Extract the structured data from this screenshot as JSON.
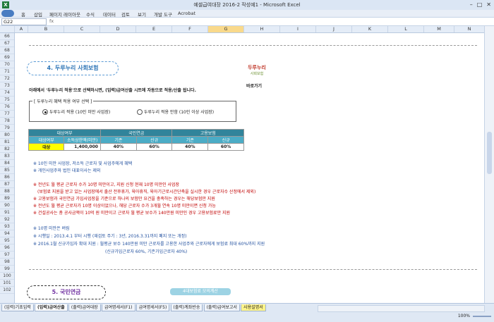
{
  "window": {
    "title": "예셀급여대장 2016-2 작성예1 - Microsoft Excel"
  },
  "ribbon_tabs": [
    "홈",
    "삽입",
    "페이지 레이아웃",
    "수식",
    "데이터",
    "검토",
    "보기",
    "개발 도구",
    "Acrobat"
  ],
  "formula_bar": {
    "name_box": "G22",
    "fx": "fx"
  },
  "columns": [
    "A",
    "B",
    "C",
    "D",
    "E",
    "F",
    "G",
    "H",
    "I",
    "J",
    "K",
    "L",
    "M",
    "N"
  ],
  "selected_column": "G",
  "rows": [
    "66",
    "67",
    "68",
    "69",
    "70",
    "71",
    "72",
    "73",
    "74",
    "75",
    "76",
    "77",
    "78",
    "79",
    "80",
    "81",
    "82",
    "83",
    "84",
    "85",
    "86",
    "87",
    "88",
    "89",
    "90",
    "91",
    "92",
    "93",
    "94",
    "95",
    "96",
    "97",
    "98",
    "99",
    "100",
    "101",
    "102"
  ],
  "section4": {
    "title": "4. 두루누리 사회보험",
    "logo_text": "두루누리",
    "logo_sub": "사회보험",
    "goto_label": "바로가기",
    "intro": "아래에서 '두루누리 적용'으로 선택하시면, (입력)급여산출 시트에 자동으로 적용/산출 됩니다.",
    "fieldset_legend": "[ 두루누리 혜택 적용 여부 선택 ]",
    "radio_apply": "두루누리 적용 (10인 미만 사업장)",
    "radio_not_apply": "두루누리 적용 안함 (10인 이상 사업장)",
    "table": {
      "header1": [
        "대상여부",
        "국민연금",
        "고용보험"
      ],
      "header2": [
        "대상여부",
        "소득상한액(미만)",
        "기존",
        "신규",
        "기존",
        "신규"
      ],
      "row": [
        "대상",
        "1,400,000",
        "40%",
        "60%",
        "40%",
        "60%"
      ]
    },
    "notes_blue": [
      "※ 10인 미만 사업장, 저소득 근로자 및 사업주에게 혜택",
      "※ 개인사업주와 법인 대표이사는 제외"
    ],
    "notes_red": [
      "※ 전년도 월 평균 근로자 수가 10명 미만이고, 지원 신청 현재 10명 미만인 사업장",
      "(보험료 지원을 받고 있는 사업장에서 출산 전후휴가, 육아휴직, 육아기근로시간단축을 실시한 경우 근로자수 산정에서 제외)",
      "※ 고용보험과 국민연금 가입사업장을 기준으로 하나의 보험만 요건을 충족하는 경우는 해당보험만 지원",
      "※ 전년도 월 평균 근로자가 10명 이상이었으나, 해당 근로자 수가 3개월 연속 10명 미만이면 신청 가능",
      "※ 건설공사는 총 공사금액이 10억 원 미만이고 근로자 월 평균 보수가 140만원 미만인 경우 고용보험료만 지원"
    ],
    "notes_blue2": [
      "※ 10명 미만은 버림",
      "※ 시행일 : 2013.4.1 부터 시행 (재검토 주기 : 3년, 2016.3.31까지 폐지 또는 개정)",
      "※ 2016.1월 신규가입자 확대 지원 : 월평균 보수 140만원 미만 근로자를 고용한 사업주와 근로자에게 보험료 최대 60%까지 지원",
      "(신규가입근로자 60%, 기존가입근로자 40%)"
    ]
  },
  "section5": {
    "title": "5. 국민연금",
    "button": "4대보험료 모의계산"
  },
  "sheet_tabs": [
    "(입력)기초입력",
    "(입력)급여산출",
    "(출력)급여대장",
    "급여명세서(F1)",
    "급여명세서(F5)",
    "(출력)계좌반송",
    "(출력)급여보고서",
    "사용설명서"
  ],
  "active_sheet": "(입력)급여산출",
  "status": {
    "zoom": "100%"
  }
}
